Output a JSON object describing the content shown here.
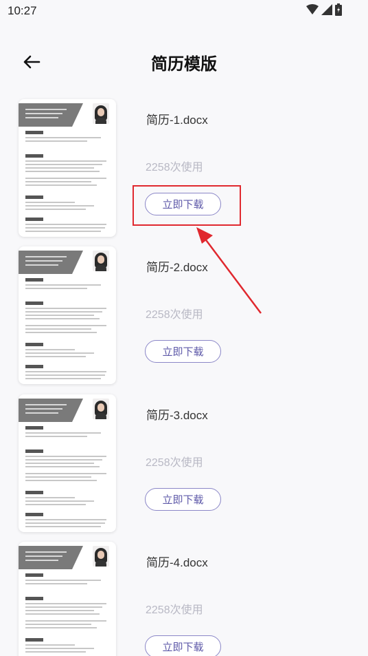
{
  "status_bar": {
    "time": "10:27"
  },
  "header": {
    "title": "简历模版"
  },
  "templates": [
    {
      "name": "简历-1.docx",
      "usage": "2258次使用",
      "button": "立即下载"
    },
    {
      "name": "简历-2.docx",
      "usage": "2258次使用",
      "button": "立即下载"
    },
    {
      "name": "简历-3.docx",
      "usage": "2258次使用",
      "button": "立即下载"
    },
    {
      "name": "简历-4.docx",
      "usage": "2258次使用",
      "button": "立即下载"
    }
  ],
  "colors": {
    "accent": "#5d58a8",
    "annotation": "#e0282e"
  }
}
